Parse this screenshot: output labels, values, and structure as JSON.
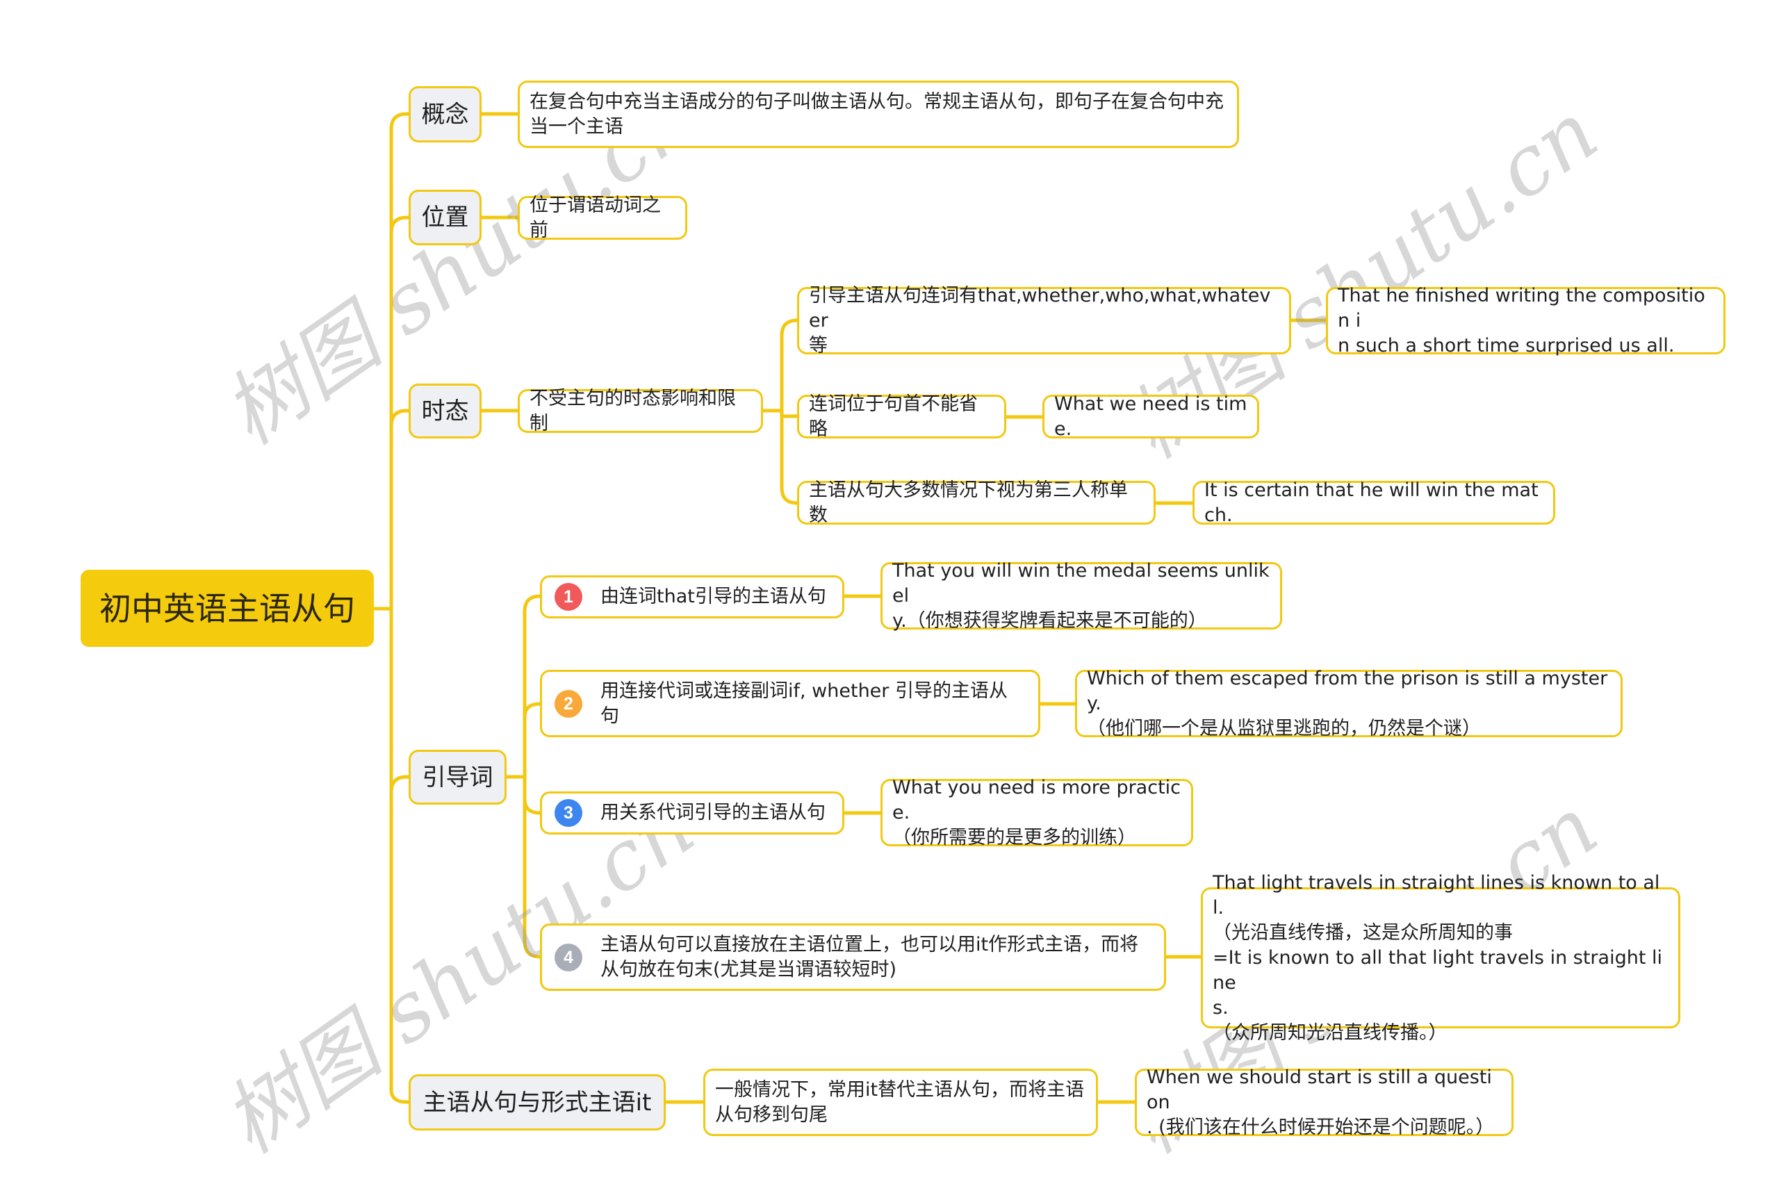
{
  "root": {
    "label": "初中英语主语从句"
  },
  "branches": {
    "concept": {
      "label": "概念",
      "desc": "在复合句中充当主语成分的句子叫做主语从句。常规主语从句，即句子在复合句中充\n当一个主语"
    },
    "position": {
      "label": "位置",
      "desc": "位于谓语动词之前"
    },
    "tense": {
      "label": "时态",
      "desc": "不受主句的时态影响和限制",
      "children": [
        {
          "label": "引导主语从句连词有that,whether,who,what,whatever\n等",
          "example": "That he finished writing the composition i\nn such a short time surprised us all."
        },
        {
          "label": "连词位于句首不能省略",
          "example": "What we need is time."
        },
        {
          "label": "主语从句大多数情况下视为第三人称单数",
          "example": "It is certain that he will win the match."
        }
      ]
    },
    "introducers": {
      "label": "引导词",
      "children": [
        {
          "badge": "1",
          "badge_color": "#f05a5a",
          "label": "由连词that引导的主语从句",
          "example": "That you will win the medal seems unlikel\ny.（你想获得奖牌看起来是不可能的）"
        },
        {
          "badge": "2",
          "badge_color": "#f9a83a",
          "label": "用连接代词或连接副词if, whether 引导的主语从\n句",
          "example": "Which of them escaped from the prison is still a mystery.\n（他们哪一个是从监狱里逃跑的，仍然是个谜）"
        },
        {
          "badge": "3",
          "badge_color": "#3d86f0",
          "label": "用关系代词引导的主语从句",
          "example": "What you need is more practice.\n（你所需要的是更多的训练）"
        },
        {
          "badge": "4",
          "badge_color": "#a9adb8",
          "label": "主语从句可以直接放在主语位置上，也可以用it作形式主语，而将\n从句放在句末(尤其是当谓语较短时)",
          "example": "That light travels in straight lines is known to all.\n（光沿直线传播，这是众所周知的事\n=It is known to all that light travels in straight line\ns.\n（众所周知光沿直线传播。）"
        }
      ]
    },
    "formal_it": {
      "label": "主语从句与形式主语it",
      "desc": "一般情况下，常用it替代主语从句，而将主语\n从句移到句尾",
      "example": "When we should start is still a question\n. (我们该在什么时候开始还是个问题呢。）"
    }
  },
  "watermark": "树图 shutu.cn",
  "colors": {
    "accent": "#f5cb0e",
    "line": "#f2c811",
    "l1_bg": "#eef0f3"
  }
}
